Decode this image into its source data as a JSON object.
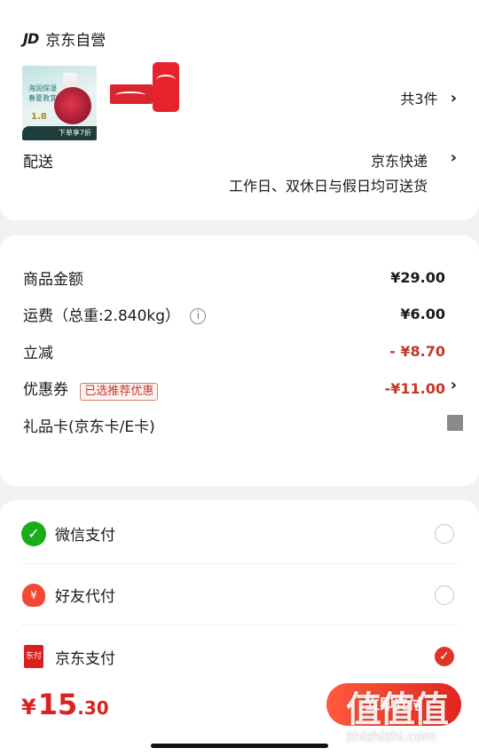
{
  "shop": {
    "logo": "JD",
    "name": "京东自營"
  },
  "products": {
    "item1": {
      "line1": "海润保湿",
      "line2": "春夏救宜",
      "price": "1.8",
      "promo": "下单享7折"
    },
    "count_label": "共3件"
  },
  "delivery": {
    "label": "配送",
    "method": "京东快递",
    "note": "工作日、双休日与假日均可送货"
  },
  "summary": {
    "goods_label": "商品金额",
    "goods_value": "¥29.00",
    "shipping_label": "运费（总重:2.840kg）",
    "shipping_value": "¥6.00",
    "discount_label": "立减",
    "discount_value": "- ¥8.70",
    "coupon_label": "优惠券",
    "coupon_tag": "已选推荐优惠",
    "coupon_value": "-¥11.00",
    "giftcard_label": "礼品卡(京东卡/E卡)"
  },
  "payment": {
    "options": [
      {
        "label": "微信支付",
        "selected": false
      },
      {
        "label": "好友代付",
        "selected": false
      },
      {
        "label": "京东支付",
        "selected": true
      }
    ]
  },
  "footer": {
    "currency": "¥",
    "total_int": "15",
    "total_dec": ".30",
    "pay_button": "立即支付"
  },
  "watermark": {
    "mark": "值值值",
    "url": "zhizhizhi.com"
  },
  "colors": {
    "accent": "#e0332a",
    "price_red": "#d8231f",
    "wechat": "#1aad19"
  }
}
